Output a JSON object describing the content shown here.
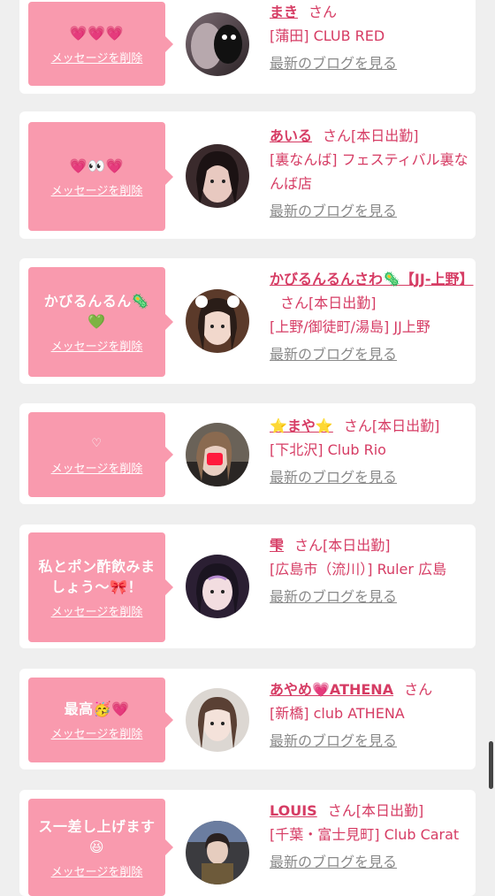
{
  "colors": {
    "bubble": "#f99aae",
    "accent": "#d63c64",
    "link_gray": "#8a8a8a",
    "page_bg": "#efefef"
  },
  "delete_label": "メッセージを削除",
  "san_label": "さん",
  "blog_label": "最新のブログを見る",
  "cards": [
    {
      "message": "💗💗💗",
      "name": "まき",
      "status": "",
      "shop": "[蒲田] CLUB RED"
    },
    {
      "message": "💗👀💗",
      "name": "あいる",
      "status": "[本日出勤]",
      "shop": "[裏なんば] フェスティバル裏なんば店"
    },
    {
      "message": "かびるんるん🦠💚",
      "name": "かびるんるんさわ🦠【JJ-上野】",
      "status": "[本日出勤]",
      "shop": "[上野/御徒町/湯島] JJ上野"
    },
    {
      "message": "♡",
      "name": "⭐まや⭐",
      "status": "[本日出勤]",
      "shop": "[下北沢] Club Rio"
    },
    {
      "message": "私とポン酢飲みましょう〜🎀！",
      "name": "雫",
      "status": "[本日出勤]",
      "shop": "[広島市（流川）] Ruler 広島"
    },
    {
      "message": "最高🥳💗",
      "name": "あやめ💗ATHENA",
      "status": "",
      "shop": "[新橋] club ATHENA"
    },
    {
      "message": "ス一差し上げます😆",
      "name": "LOUIS",
      "status": "[本日出勤]",
      "shop": "[千葉・富士見町] Club Carat"
    }
  ]
}
